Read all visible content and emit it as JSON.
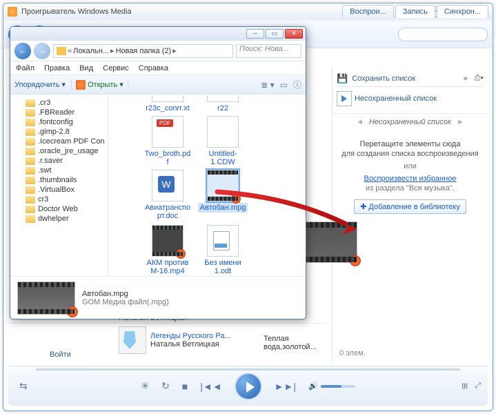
{
  "wmp": {
    "title": "Проигрыватель Windows Media",
    "tabs": {
      "play": "Воспрои...",
      "burn": "Запись",
      "sync": "Синхрон..."
    },
    "savelist": "Сохранить список",
    "newlist_link": "Несохраненный список",
    "list_title": "Несохраненный список",
    "drop": {
      "main": "Перетащите элементы сюда",
      "sub": "для создания списка воспроизведения",
      "or": "или",
      "link": "Воспроизвести избранное",
      "sub2": "из раздела \"Вся музыка\".",
      "libbtn": "Добавление в библиотеку"
    },
    "count": "0 элем.",
    "login": "Войти",
    "artist": "Наталья Ветлицкая",
    "album_line1": "Легенды Русского Ра...",
    "album_line2": "Наталья Ветлицкая",
    "track": "Теплая вода,золотой..."
  },
  "explorer": {
    "crumb1": "Локальн...",
    "crumb2": "Новая папка (2)",
    "search_ph": "Поиск: Нова...",
    "menu": {
      "file": "Файл",
      "edit": "Правка",
      "view": "Вид",
      "service": "Сервис",
      "help": "Справка"
    },
    "organize": "Упорядочить",
    "open": "Открыть",
    "tree": [
      ".cr3",
      ".FBReader",
      ".fontconfig",
      ".gimp-2.8",
      ".Icecream PDF Con",
      ".oracle_jre_usage",
      ".r.saver",
      ".swt",
      ".thumbnails",
      ".VirtualBox",
      "cr3",
      "Doctor Web",
      "dwhelper"
    ],
    "files": {
      "f0": "r23c_conrr.xt",
      "f1": "r22",
      "pdf": "Two_broth.pdf",
      "cdw": "Untitled-1.CDW",
      "doc": "Авиатранспорт.doc",
      "mpg": "Автобан.mpg",
      "mp4": "АКМ против М-16.mp4",
      "odt": "Без имени 1.odt"
    },
    "status": {
      "name": "Автобан.mpg",
      "type": "GOM Медиа файл(.mpg)"
    }
  }
}
